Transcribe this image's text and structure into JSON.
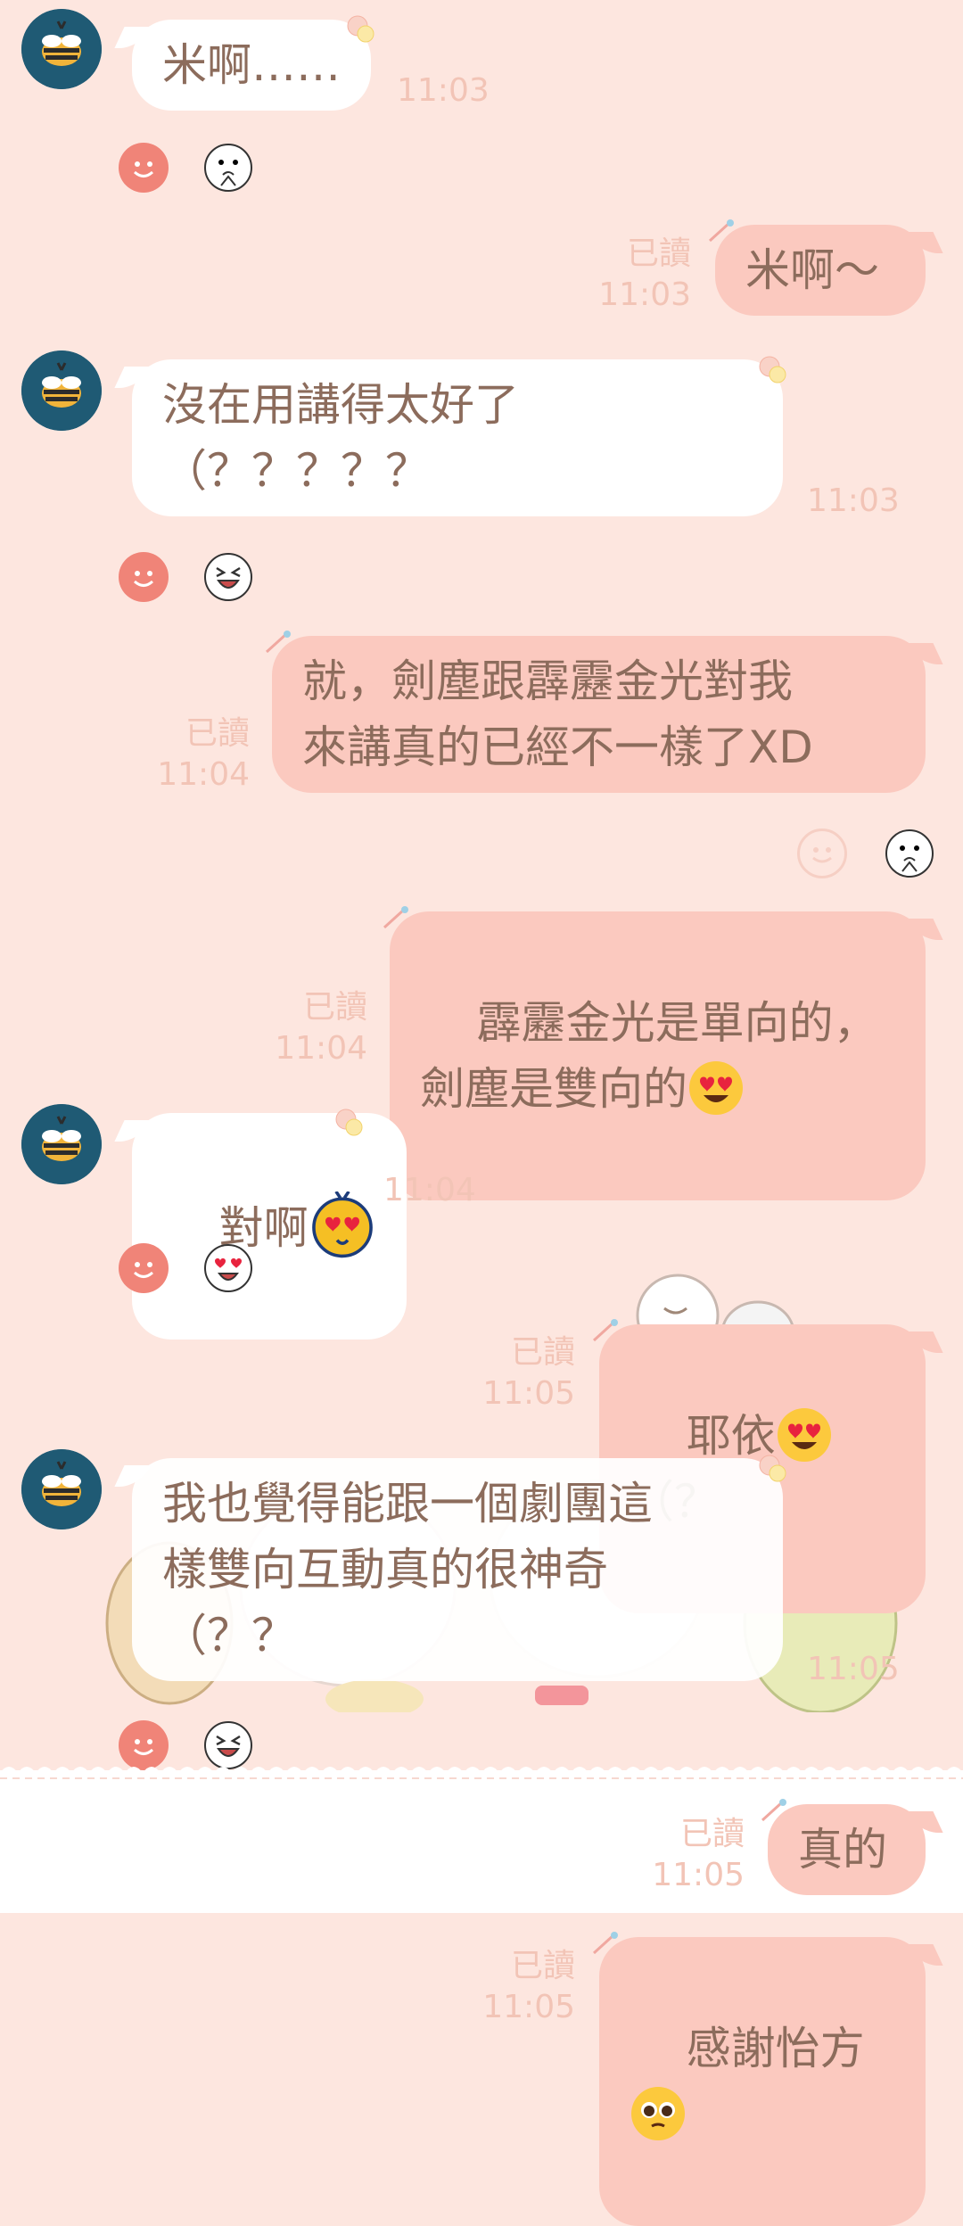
{
  "messages": [
    {
      "id": "m1",
      "side": "in",
      "text": "米啊……",
      "time": "11:03"
    },
    {
      "id": "m2",
      "side": "out",
      "text": "米啊～",
      "read": "已讀",
      "time": "11:03"
    },
    {
      "id": "m3",
      "side": "in",
      "text": "沒在用講得太好了\n（？？？？？",
      "time": "11:03"
    },
    {
      "id": "m4",
      "side": "out",
      "text": "就，劍塵跟霹靂金光對我\n來講真的已經不一樣了XD",
      "read": "已讀",
      "time": "11:04"
    },
    {
      "id": "m5",
      "side": "out",
      "text": "霹靂金光是單向的，\n劍塵是雙向的",
      "read": "已讀",
      "time": "11:04"
    },
    {
      "id": "m6",
      "side": "in",
      "text": "對啊",
      "time": "11:04"
    },
    {
      "id": "m7",
      "side": "out",
      "text": "耶依",
      "text_after": "（？",
      "read": "已讀",
      "time": "11:05"
    },
    {
      "id": "m8",
      "side": "in",
      "text": "我也覺得能跟一個劇團這\n樣雙向互動真的很神奇\n（？？",
      "time": "11:05"
    },
    {
      "id": "m9",
      "side": "out",
      "text": "真的",
      "read": "已讀",
      "time": "11:05"
    },
    {
      "id": "m10",
      "side": "out",
      "text": "感謝怡方",
      "read": "已讀",
      "time": "11:05"
    }
  ],
  "reactions": {
    "r1": "smile-icon",
    "r2": "praying-face-icon",
    "r3": "laughing-face-icon",
    "r4": "heart-eyes-face-icon"
  },
  "colors": {
    "background": "#fde6df",
    "incoming_bubble": "#ffffff",
    "outgoing_bubble": "#fbc9bf",
    "text": "#8c6c5c",
    "meta": "#f2c4b6",
    "avatar": "#1f5a74",
    "reaction_pink": "#f08478"
  }
}
